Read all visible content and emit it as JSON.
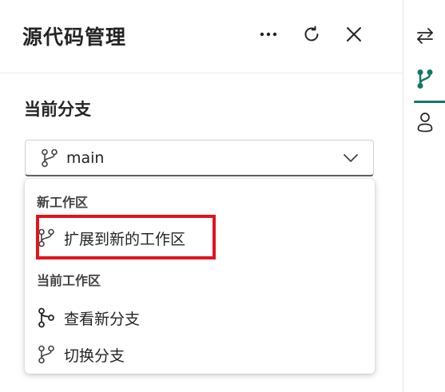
{
  "panel": {
    "title": "源代码管理",
    "more_icon": "more-horizontal-icon",
    "refresh_icon": "refresh-icon",
    "close_icon": "close-icon"
  },
  "current_branch": {
    "section_label": "当前分支",
    "selected_value": "main",
    "icon": "branch-icon",
    "chevron": "chevron-down-icon"
  },
  "dropdown": {
    "groups": [
      {
        "label": "新工作区",
        "items": [
          {
            "label": "扩展到新的工作区",
            "icon": "branch-icon"
          }
        ]
      },
      {
        "label": "当前工作区",
        "items": [
          {
            "label": "查看新分支",
            "icon": "branch-fork-icon"
          },
          {
            "label": "切换分支",
            "icon": "branch-icon"
          }
        ]
      }
    ]
  },
  "right_rail": {
    "items": [
      {
        "icon": "swap-arrows-icon",
        "active": false
      },
      {
        "icon": "branch-icon",
        "active": true
      },
      {
        "icon": "person-icon",
        "active": false
      }
    ]
  },
  "colors": {
    "accent": "#117865",
    "highlight": "#e0141e",
    "text": "#242424"
  }
}
